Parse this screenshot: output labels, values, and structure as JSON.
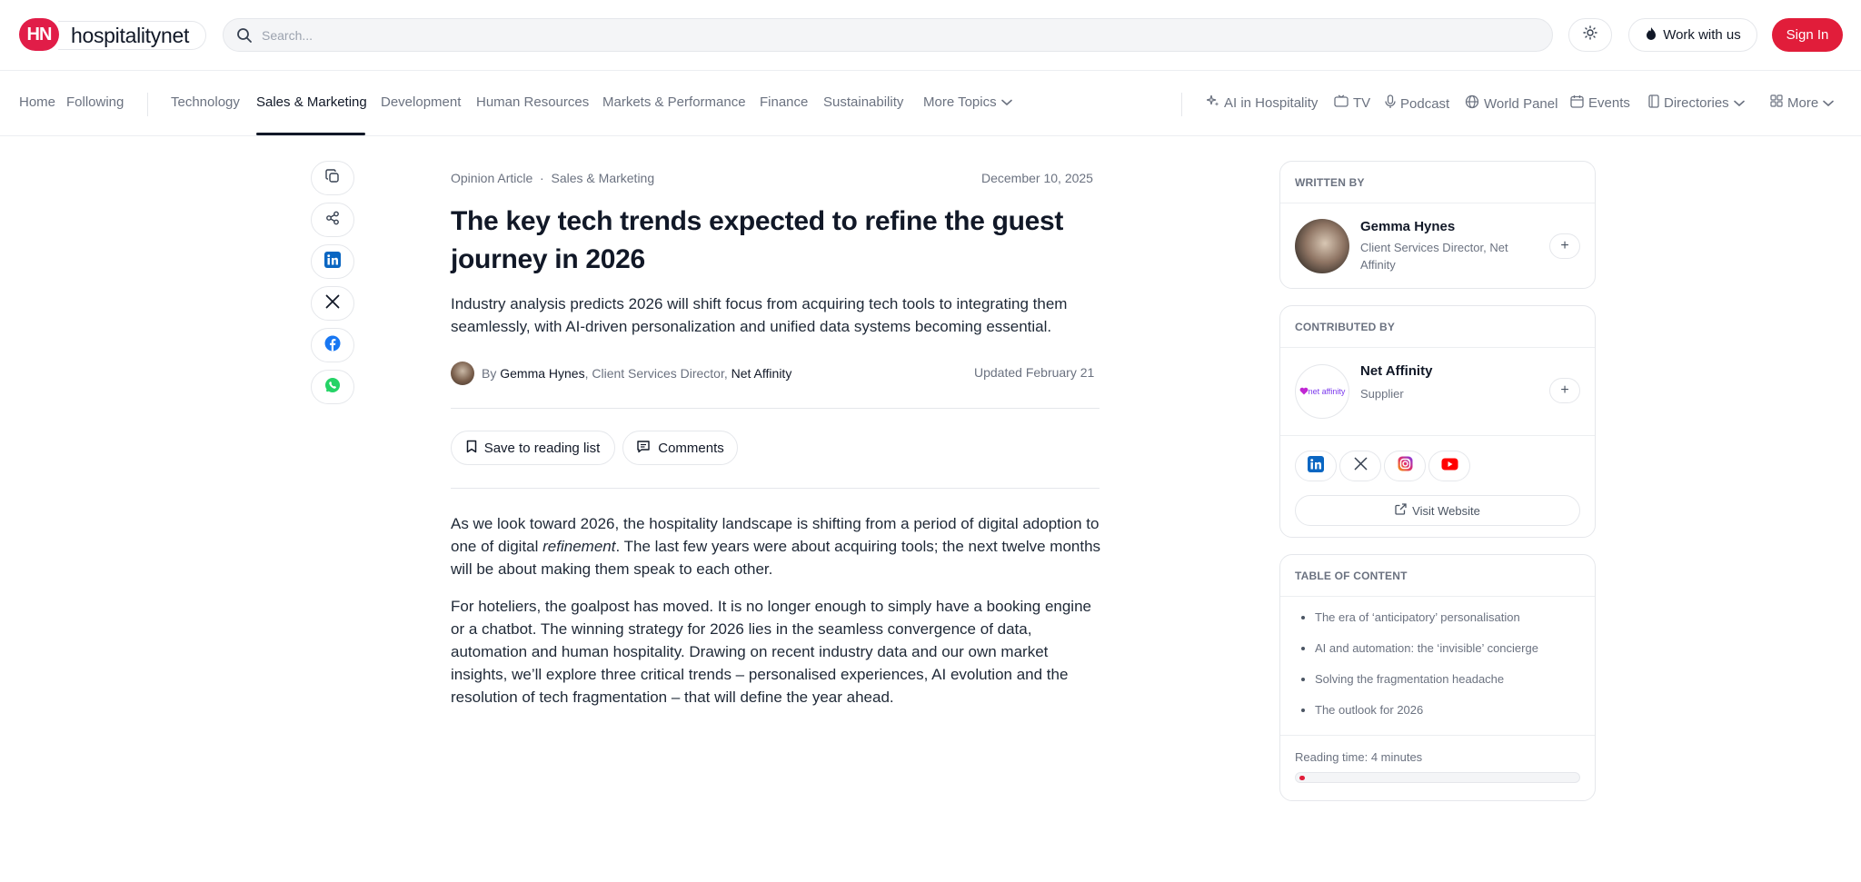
{
  "brand": {
    "logo_letters": "HN",
    "name": "hospitalitynet",
    "accent": "#e11d3a"
  },
  "header": {
    "search_placeholder": "Search...",
    "work_label": "Work with us",
    "signin_label": "Sign In"
  },
  "nav": {
    "left": [
      "Home",
      "Following"
    ],
    "topics": [
      "Technology",
      "Sales & Marketing",
      "Development",
      "Human Resources",
      "Markets & Performance",
      "Finance",
      "Sustainability"
    ],
    "more_topics": "More Topics",
    "active": "Sales & Marketing",
    "right": [
      "AI in Hospitality",
      "TV",
      "Podcast",
      "World Panel",
      "Events",
      "Directories",
      "More"
    ]
  },
  "article": {
    "type": "Opinion Article",
    "category": "Sales & Marketing",
    "date": "December 10, 2025",
    "title": "The key tech trends expected to refine the guest journey in 2026",
    "lede": "Industry analysis predicts 2026 will shift focus from acquiring tech tools to integrating them seamlessly, with AI-driven personalization and unified data systems becoming essential.",
    "by": "By",
    "author": "Gemma Hynes",
    "author_role": ", Client Services Director,",
    "author_company": "Net Affinity",
    "updated": "Updated February 21",
    "save_label": "Save to reading list",
    "comments_label": "Comments",
    "p1_a": "As we look toward 2026, the hospitality landscape is shifting from a period of digital adoption to one of digital ",
    "p1_em": "refinement",
    "p1_b": ". The last few years were about acquiring tools; the next twelve months will be about making them speak to each other.",
    "p2": "For hoteliers, the goalpost has moved. It is no longer enough to simply have a booking engine or a chatbot. The winning strategy for 2026 lies in the seamless convergence of data, automation and human hospitality. Drawing on recent industry data and our own market insights, we’ll explore three critical trends – personalised experiences, AI evolution and the resolution of tech fragmentation – that will define the year ahead."
  },
  "sidebar": {
    "written_by": "WRITTEN BY",
    "writer_name": "Gemma Hynes",
    "writer_role": "Client Services Director, Net Affinity",
    "contributed_by": "CONTRIBUTED BY",
    "contrib_logo_text": "net affinity",
    "contrib_name": "Net Affinity",
    "contrib_type": "Supplier",
    "visit_label": "Visit Website",
    "toc_title": "TABLE OF CONTENT",
    "toc": [
      "The era of ‘anticipatory’ personalisation",
      "AI and automation: the ‘invisible’ concierge",
      "Solving the fragmentation headache",
      "The outlook for 2026"
    ],
    "reading_time": "Reading time: 4 minutes",
    "reading_progress": 0.02
  }
}
